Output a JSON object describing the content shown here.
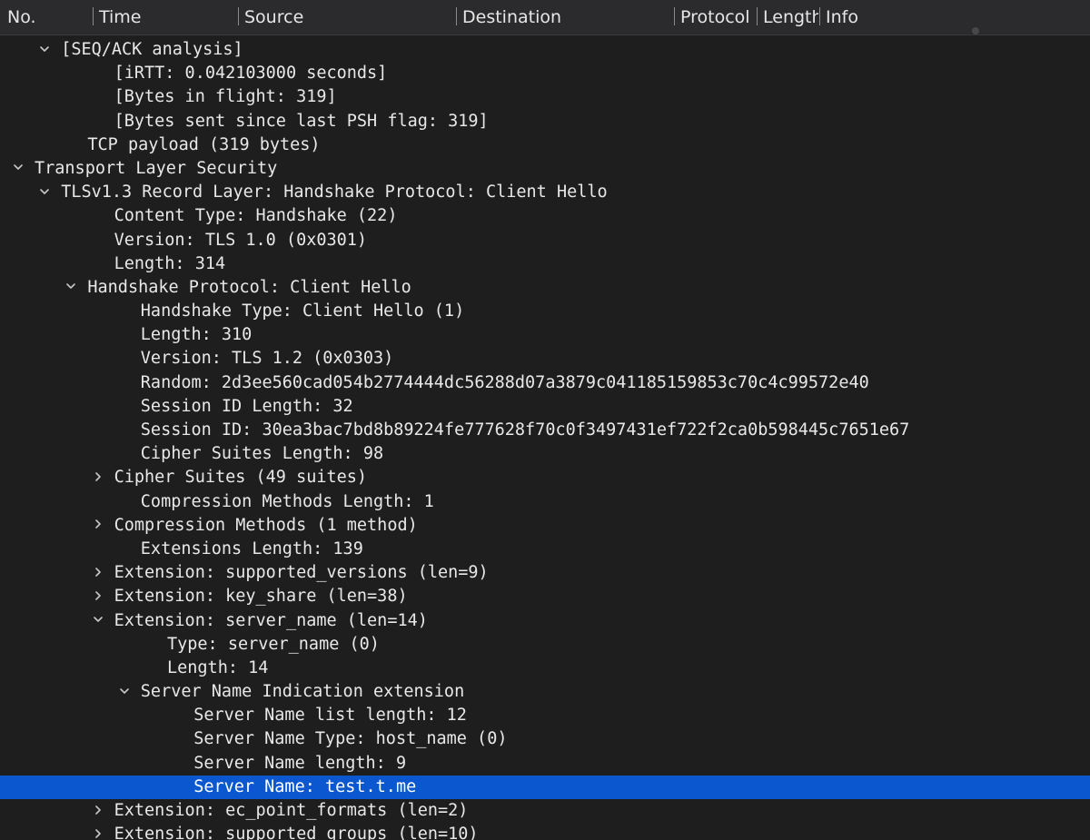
{
  "columns": {
    "no": "No.",
    "time": "Time",
    "source": "Source",
    "destination": "Destination",
    "protocol": "Protocol",
    "length": "Length",
    "info": "Info"
  },
  "tree": [
    {
      "text": "[SEQ/ACK analysis]",
      "level": 1,
      "toggle": "expanded"
    },
    {
      "text": "[iRTT: 0.042103000 seconds]",
      "level": 3,
      "toggle": "none"
    },
    {
      "text": "[Bytes in flight: 319]",
      "level": 3,
      "toggle": "none"
    },
    {
      "text": "[Bytes sent since last PSH flag: 319]",
      "level": 3,
      "toggle": "none"
    },
    {
      "text": "TCP payload (319 bytes)",
      "level": 2,
      "toggle": "none"
    },
    {
      "text": "Transport Layer Security",
      "level": 0,
      "toggle": "expanded"
    },
    {
      "text": "TLSv1.3 Record Layer: Handshake Protocol: Client Hello",
      "level": 1,
      "toggle": "expanded"
    },
    {
      "text": "Content Type: Handshake (22)",
      "level": 3,
      "toggle": "none"
    },
    {
      "text": "Version: TLS 1.0 (0x0301)",
      "level": 3,
      "toggle": "none"
    },
    {
      "text": "Length: 314",
      "level": 3,
      "toggle": "none"
    },
    {
      "text": "Handshake Protocol: Client Hello",
      "level": 2,
      "toggle": "expanded"
    },
    {
      "text": "Handshake Type: Client Hello (1)",
      "level": 4,
      "toggle": "none"
    },
    {
      "text": "Length: 310",
      "level": 4,
      "toggle": "none"
    },
    {
      "text": "Version: TLS 1.2 (0x0303)",
      "level": 4,
      "toggle": "none"
    },
    {
      "text": "Random: 2d3ee560cad054b2774444dc56288d07a3879c041185159853c70c4c99572e40",
      "level": 4,
      "toggle": "none"
    },
    {
      "text": "Session ID Length: 32",
      "level": 4,
      "toggle": "none"
    },
    {
      "text": "Session ID: 30ea3bac7bd8b89224fe777628f70c0f3497431ef722f2ca0b598445c7651e67",
      "level": 4,
      "toggle": "none"
    },
    {
      "text": "Cipher Suites Length: 98",
      "level": 4,
      "toggle": "none"
    },
    {
      "text": "Cipher Suites (49 suites)",
      "level": 3,
      "toggle": "collapsed"
    },
    {
      "text": "Compression Methods Length: 1",
      "level": 4,
      "toggle": "none"
    },
    {
      "text": "Compression Methods (1 method)",
      "level": 3,
      "toggle": "collapsed"
    },
    {
      "text": "Extensions Length: 139",
      "level": 4,
      "toggle": "none"
    },
    {
      "text": "Extension: supported_versions (len=9)",
      "level": 3,
      "toggle": "collapsed"
    },
    {
      "text": "Extension: key_share (len=38)",
      "level": 3,
      "toggle": "collapsed"
    },
    {
      "text": "Extension: server_name (len=14)",
      "level": 3,
      "toggle": "expanded"
    },
    {
      "text": "Type: server_name (0)",
      "level": 5,
      "toggle": "none"
    },
    {
      "text": "Length: 14",
      "level": 5,
      "toggle": "none"
    },
    {
      "text": "Server Name Indication extension",
      "level": 4,
      "toggle": "expanded"
    },
    {
      "text": "Server Name list length: 12",
      "level": 6,
      "toggle": "none"
    },
    {
      "text": "Server Name Type: host_name (0)",
      "level": 6,
      "toggle": "none"
    },
    {
      "text": "Server Name length: 9",
      "level": 6,
      "toggle": "none"
    },
    {
      "text": "Server Name: test.t.me",
      "level": 6,
      "toggle": "none",
      "selected": true
    },
    {
      "text": "Extension: ec_point_formats (len=2)",
      "level": 3,
      "toggle": "collapsed"
    },
    {
      "text": "Extension: supported_groups (len=10)",
      "level": 3,
      "toggle": "collapsed"
    }
  ],
  "colors": {
    "background": "#1e1e1e",
    "header": "#2b2b2d",
    "selection": "#0a57d0",
    "text": "#e8e8e8"
  }
}
